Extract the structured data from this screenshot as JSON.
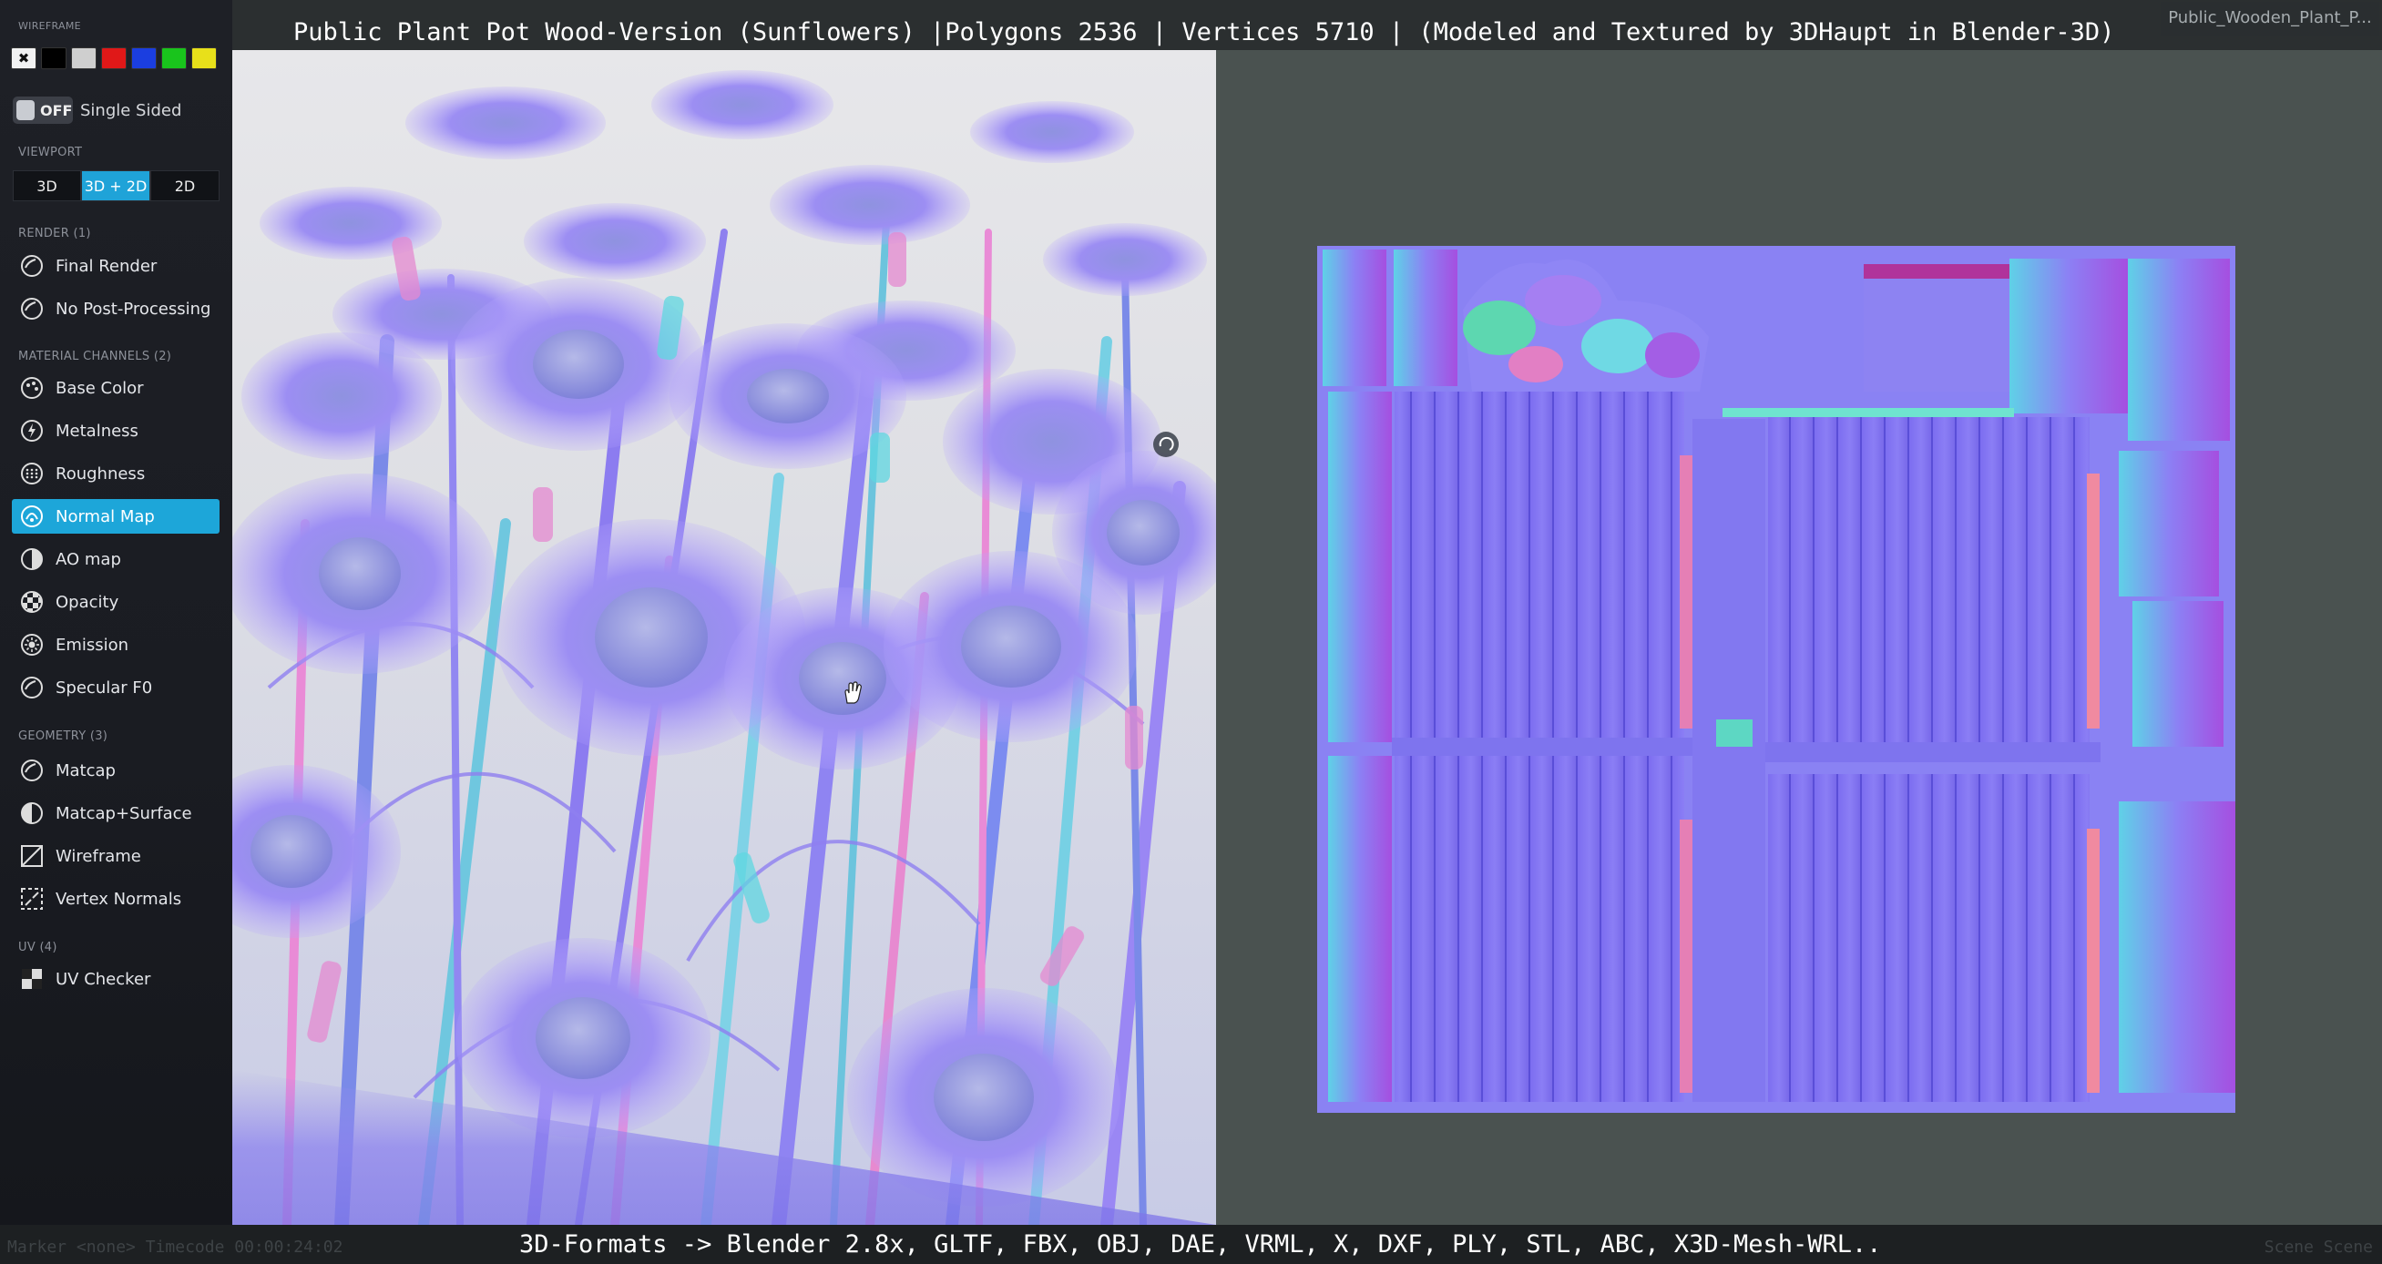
{
  "title": "Public Plant Pot Wood-Version (Sunflowers) |Polygons 2536 | Vertices 5710 | (Modeled and Textured by 3DHaupt in Blender-3D)",
  "corner_label": "Public_Wooden_Plant_P...",
  "bottom_formats": "3D-Formats -> Blender 2.8x, GLTF, FBX, OBJ, DAE, VRML, X, DXF, PLY, STL, ABC, X3D-Mesh-WRL..",
  "bottom_faint_left": "Marker <none>   Timecode 00:00:24:02",
  "bottom_faint_right": "Scene Scene",
  "sidebar": {
    "wireframe_label": "WIREFRAME",
    "swatches": [
      "#ffffff",
      "#000000",
      "#cfcfcf",
      "#e01818",
      "#1b3ee0",
      "#19c41c",
      "#e8e01a"
    ],
    "swatch_reset_glyph": "✖",
    "single_sided": {
      "toggle_text": "OFF",
      "label": "Single Sided"
    },
    "viewport": {
      "label": "VIEWPORT",
      "buttons": [
        "3D",
        "3D + 2D",
        "2D"
      ],
      "active": "3D + 2D"
    },
    "render": {
      "label": "RENDER (1)",
      "items": [
        "Final Render",
        "No Post-Processing"
      ]
    },
    "material_channels": {
      "label": "MATERIAL CHANNELS (2)",
      "items": [
        "Base Color",
        "Metalness",
        "Roughness",
        "Normal Map",
        "AO map",
        "Opacity",
        "Emission",
        "Specular F0"
      ],
      "active": "Normal Map"
    },
    "geometry": {
      "label": "GEOMETRY (3)",
      "items": [
        "Matcap",
        "Matcap+Surface",
        "Wireframe",
        "Vertex Normals"
      ]
    },
    "uv": {
      "label": "UV (4)",
      "items": [
        "UV Checker"
      ]
    }
  },
  "colors": {
    "accent": "#1da6d9",
    "normal_map_base": "#8077f2",
    "normal_map_pink": "#e58ad0",
    "normal_map_cyan": "#5fd7e0"
  }
}
